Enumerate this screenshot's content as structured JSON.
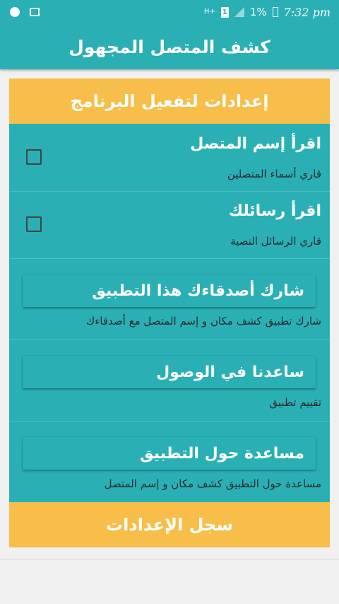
{
  "status_bar": {
    "left_icons": [
      "settings-circle-icon",
      "image-icon"
    ],
    "network_label": "H+",
    "sim_label": "1",
    "battery_percent": "1%",
    "time": "7:32 pm"
  },
  "app_bar": {
    "title": "كشف المتصل المجهول"
  },
  "settings_card": {
    "header": "إعدادات لتفعيل البرنامج",
    "options": [
      {
        "title": "اقرأ إسم المتصل",
        "subtitle": "قاري أسماء المتصلين",
        "checked": false
      },
      {
        "title": "اقرأ رسائلك",
        "subtitle": "قاري الرسائل النصية",
        "checked": false
      }
    ],
    "actions": [
      {
        "label": "شارك أصدقاءك هذا التطبيق",
        "subtitle": "شارك تطبيق كشف مكان و إسم المتصل مع أصدقاءك"
      },
      {
        "label": "ساعدنا في الوصول",
        "subtitle": "تقييم تطبيق"
      },
      {
        "label": "مساعدة حول التطبيق",
        "subtitle": "مساعدة حول التطبيق كشف مكان و إسم المتصل"
      }
    ],
    "save_label": "سجل الإعدادات"
  },
  "colors": {
    "primary": "#2ab0b4",
    "accent": "#f8be4a"
  }
}
